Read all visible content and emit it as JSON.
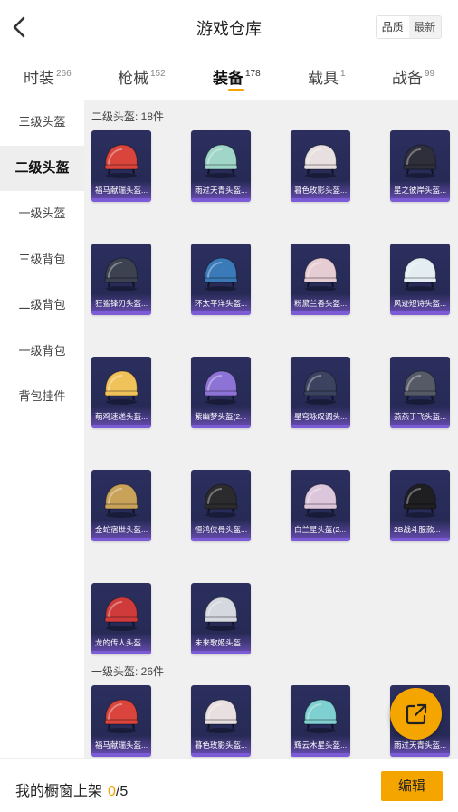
{
  "header": {
    "title": "游戏仓库",
    "back_icon": "chevron-left-icon",
    "sort_options": [
      "品质",
      "最新"
    ],
    "sort_selected": "最新"
  },
  "tabs": [
    {
      "label": "时装",
      "count": "266"
    },
    {
      "label": "枪械",
      "count": "152"
    },
    {
      "label": "装备",
      "count": "178",
      "active": true
    },
    {
      "label": "载具",
      "count": "1"
    },
    {
      "label": "战备",
      "count": "99"
    }
  ],
  "sidebar": {
    "items": [
      "三级头盔",
      "二级头盔",
      "一级头盔",
      "三级背包",
      "二级背包",
      "一级背包",
      "背包挂件"
    ],
    "active": "二级头盔"
  },
  "sections": [
    {
      "title": "二级头盔: 18件",
      "items": [
        {
          "name": "福马献瑞头盔...",
          "color": "#d9453c"
        },
        {
          "name": "雨过天青头盔...",
          "color": "#9fd6c8"
        },
        {
          "name": "暮色玫影头盔...",
          "color": "#e8e0e0"
        },
        {
          "name": "星之彼岸头盔...",
          "color": "#2e2f3a"
        },
        {
          "name": "狂鲨锋刃头盔...",
          "color": "#3c4250"
        },
        {
          "name": "环太平洋头盔...",
          "color": "#3a7ab8"
        },
        {
          "name": "粉黛兰香头盔...",
          "color": "#e6cdd3"
        },
        {
          "name": "风迹短诗头盔...",
          "color": "#e4eef2"
        },
        {
          "name": "萌鸡速递头盔...",
          "color": "#f0c25a"
        },
        {
          "name": "紫幽梦头盔(2...",
          "color": "#8e73d6"
        },
        {
          "name": "星穹咏叹调头...",
          "color": "#3b4360"
        },
        {
          "name": "燕燕于飞头盔...",
          "color": "#555a66"
        },
        {
          "name": "金蛇宿世头盔...",
          "color": "#c9a25a"
        },
        {
          "name": "恒鸿侠骨头盔...",
          "color": "#2b2b2e"
        },
        {
          "name": "白兰星头盔(2...",
          "color": "#dcc6dc"
        },
        {
          "name": "2B战斗服款...",
          "color": "#1f1f22"
        },
        {
          "name": "龙的传人头盔...",
          "color": "#cf3b3b"
        },
        {
          "name": "未来歌姬头盔...",
          "color": "#d5d8de"
        }
      ]
    },
    {
      "title": "一级头盔: 26件",
      "items": [
        {
          "name": "福马献瑞头盔...",
          "color": "#d9453c"
        },
        {
          "name": "暮色玫影头盔...",
          "color": "#e8e0e0"
        },
        {
          "name": "辉云木星头盔...",
          "color": "#7fd0d0"
        },
        {
          "name": "雨过天青头盔...",
          "color": "#9fd6c8"
        }
      ]
    }
  ],
  "fab": {
    "icon": "share-external-icon"
  },
  "footer": {
    "label": "我的橱窗上架",
    "count": "0",
    "total": "/5",
    "edit_label": "编辑"
  },
  "colors": {
    "accent": "#f5a500",
    "card_bg": "#2a2d5a",
    "card_bar": "#7b5cd6"
  }
}
